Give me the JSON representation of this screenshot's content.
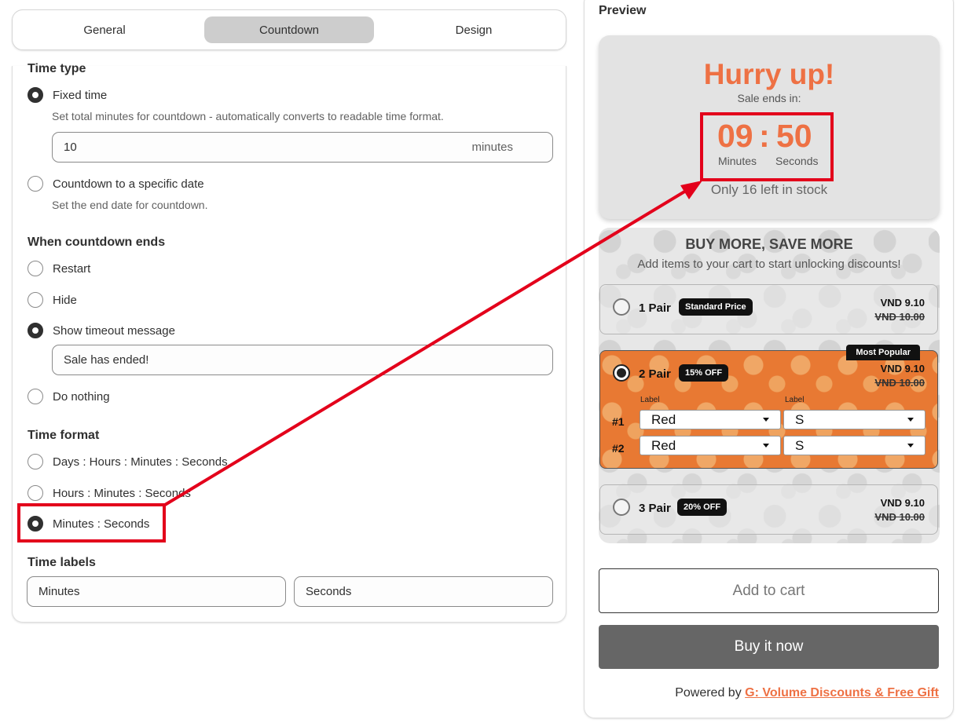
{
  "tabs": [
    "General",
    "Countdown",
    "Design"
  ],
  "active_tab": "Countdown",
  "settings": {
    "time_type": {
      "title": "Time type",
      "fixed_label": "Fixed time",
      "fixed_help": "Set total minutes for countdown - automatically converts to readable time format.",
      "minutes_value": "10",
      "minutes_suffix": "minutes",
      "date_label": "Countdown to a specific date",
      "date_help": "Set the end date for countdown."
    },
    "when_ends": {
      "title": "When countdown ends",
      "options": [
        "Restart",
        "Hide",
        "Show timeout message",
        "Do nothing"
      ],
      "selected": "Show timeout message",
      "timeout_message": "Sale has ended!"
    },
    "time_format": {
      "title": "Time format",
      "options": [
        "Days : Hours : Minutes : Seconds",
        "Hours : Minutes : Seconds",
        "Minutes : Seconds"
      ],
      "selected": "Minutes : Seconds"
    },
    "time_labels": {
      "title": "Time labels",
      "minutes": "Minutes",
      "seconds": "Seconds"
    }
  },
  "preview": {
    "title": "Preview",
    "heading": "Hurry up!",
    "subheading": "Sale ends in:",
    "minutes": "09",
    "separator": ":",
    "seconds": "50",
    "minutes_label": "Minutes",
    "seconds_label": "Seconds",
    "stock_text": "Only 16 left in stock",
    "bundle": {
      "title": "BUY MORE, SAVE MORE",
      "subtitle": "Add items to your cart to start unlocking discounts!",
      "tiers": [
        {
          "name": "1 Pair",
          "badge": "Standard Price",
          "price": "VND 9.10",
          "old_price": "VND 10.00"
        },
        {
          "name": "2 Pair",
          "badge": "15% OFF",
          "price": "VND 9.10",
          "old_price": "VND 10.00",
          "tag": "Most Popular",
          "label_a": "Label",
          "label_b": "Label",
          "rows": [
            {
              "num": "#1",
              "color": "Red",
              "size": "S"
            },
            {
              "num": "#2",
              "color": "Red",
              "size": "S"
            }
          ]
        },
        {
          "name": "3 Pair",
          "badge": "20% OFF",
          "price": "VND 9.10",
          "old_price": "VND 10.00"
        }
      ]
    },
    "add_to_cart": "Add to cart",
    "buy_now": "Buy it now",
    "powered_prefix": "Powered by",
    "powered_link": "G: Volume Discounts & Free Gift"
  },
  "colors": {
    "accent": "#ee7144",
    "highlight": "#e3001b",
    "selected_tier": "#e87933"
  }
}
